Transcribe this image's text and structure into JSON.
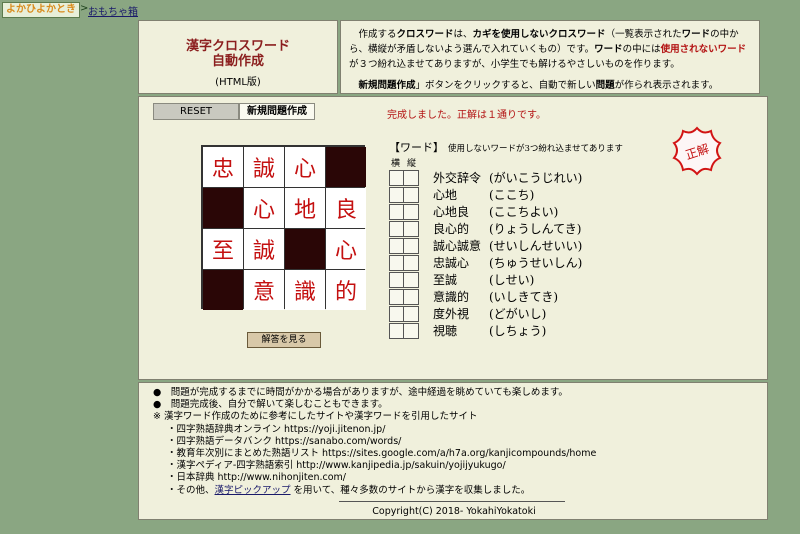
{
  "topbar": {
    "logo": "よかひよかとき",
    "separator": ">",
    "crumb": "おもちゃ箱"
  },
  "title": {
    "line1": "漢字クロスワード",
    "line2": "自動作成",
    "line3": "(HTML版)"
  },
  "description": {
    "p1_a": "作成する",
    "p1_b": "クロスワード",
    "p1_c": "は、",
    "p1_d": "カギを使用しないクロスワード",
    "p1_e": "（一覧表示された",
    "p1_f": "ワード",
    "p1_g": "の中から、横縦が矛盾しないよう選んで入れていくもの）です。",
    "p1_h": "ワード",
    "p1_i": "の中には",
    "p1_j": "使用されないワード",
    "p1_k": "が３つ紛れ込ませてありますが、小学生でも解けるやさしいものを作ります。",
    "p2_a": "新規問題作成",
    "p2_b": "」ボタンをクリックすると、自動で新しい",
    "p2_c": "問題",
    "p2_d": "が作られ表示されます。"
  },
  "buttons": {
    "reset": "RESET",
    "new": "新規問題作成",
    "answer": "解答を見る"
  },
  "status": "完成しました。正解は１通りです。",
  "grid": [
    [
      "忠",
      "誠",
      "心",
      ""
    ],
    [
      "",
      "心",
      "地",
      "良"
    ],
    [
      "至",
      "誠",
      "",
      "心"
    ],
    [
      "",
      "意",
      "識",
      "的"
    ]
  ],
  "words_header": "【ワード】",
  "words_note": "使用しないワードが3つ紛れ込ませてあります",
  "col_labels": {
    "horizontal": "横",
    "vertical": "縦"
  },
  "words": [
    {
      "word": "外交辞令",
      "reading": "(がいこうじれい)"
    },
    {
      "word": "心地",
      "reading": "(ここち)"
    },
    {
      "word": "心地良",
      "reading": "(ここちよい)"
    },
    {
      "word": "良心的",
      "reading": "(りょうしんてき)"
    },
    {
      "word": "誠心誠意",
      "reading": "(せいしんせいい)"
    },
    {
      "word": "忠誠心",
      "reading": "(ちゅうせいしん)"
    },
    {
      "word": "至誠",
      "reading": "(しせい)"
    },
    {
      "word": "意識的",
      "reading": "(いしきてき)"
    },
    {
      "word": "度外視",
      "reading": "(どがいし)"
    },
    {
      "word": "視聴",
      "reading": "(しちょう)"
    }
  ],
  "seal_text": "正解",
  "notes": {
    "n1": "●　問題が完成するまでに時間がかかる場合がありますが、途中経過を眺めていても楽しめます。",
    "n2": "●　問題完成後、自分で解いて楽しむこともできます。",
    "n3": "※ 漢字ワード作成のために参考にしたサイトや漢字ワードを引用したサイト",
    "s1": "・四字熟語辞典オンライン https://yoji.jitenon.jp/",
    "s2": "・四字熟語データバンク https://sanabo.com/words/",
    "s3": "・教育年次別にまとめた熟語リスト https://sites.google.com/a/h7a.org/kanjicompounds/home",
    "s4": "・漢字ペディア-四字熟語索引 http://www.kanjipedia.jp/sakuin/yojijyukugo/",
    "s5": "・日本辞典 http://www.nihonjiten.com/",
    "s6_a": "・その他、",
    "s6_link": "漢字ピックアップ",
    "s6_b": " を用いて、種々多数のサイトから漢字を収集しました。",
    "copyright": "Copyright(C) 2018- YokahiYokatoki"
  },
  "colors": {
    "background": "#8aa682",
    "panel": "#f0f0dc",
    "accent_red": "#c41010",
    "black_cell": "#2a0606"
  }
}
